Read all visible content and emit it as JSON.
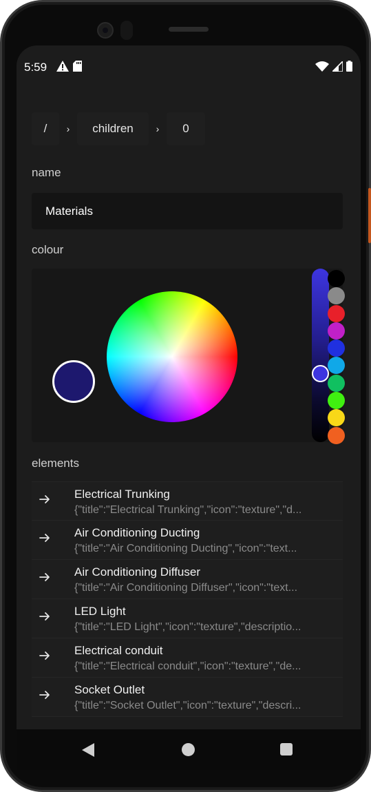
{
  "status": {
    "time": "5:59",
    "left_icons": [
      "warning-icon",
      "sd-card-icon"
    ],
    "right_icons": [
      "wifi-icon",
      "signal-icon",
      "battery-icon"
    ]
  },
  "breadcrumb": {
    "root": "/",
    "separator": "›",
    "items": [
      "children",
      "0"
    ]
  },
  "name": {
    "label": "name",
    "value": "Materials"
  },
  "colour": {
    "label": "colour",
    "selected": "#1d186e",
    "slider_color": "#3d35e0",
    "swatches": [
      "#000000",
      "#8a8a8a",
      "#e8202a",
      "#c020c8",
      "#2030e0",
      "#10a8e8",
      "#10c060",
      "#40f010",
      "#f8d818",
      "#f06020"
    ]
  },
  "elements": {
    "label": "elements",
    "items": [
      {
        "title": "Electrical Trunking",
        "subtitle": "{\"title\":\"Electrical Trunking\",\"icon\":\"texture\",\"d..."
      },
      {
        "title": "Air Conditioning Ducting",
        "subtitle": "{\"title\":\"Air Conditioning Ducting\",\"icon\":\"text..."
      },
      {
        "title": "Air Conditioning Diffuser",
        "subtitle": "{\"title\":\"Air Conditioning Diffuser\",\"icon\":\"text..."
      },
      {
        "title": "LED Light",
        "subtitle": "{\"title\":\"LED Light\",\"icon\":\"texture\",\"descriptio..."
      },
      {
        "title": "Electrical conduit",
        "subtitle": "{\"title\":\"Electrical conduit\",\"icon\":\"texture\",\"de..."
      },
      {
        "title": "Socket Outlet",
        "subtitle": "{\"title\":\"Socket Outlet\",\"icon\":\"texture\",\"descri..."
      }
    ]
  },
  "navigation": {
    "icons": [
      "back-icon",
      "home-icon",
      "recents-icon"
    ]
  }
}
